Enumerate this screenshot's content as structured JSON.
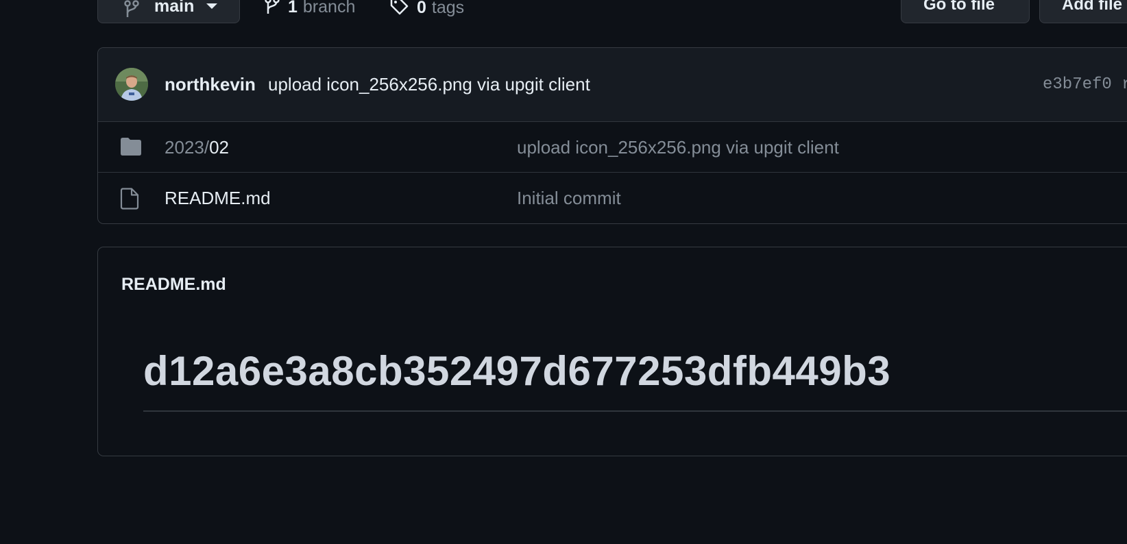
{
  "toolbar": {
    "branch": "main",
    "branch_count": "1",
    "branch_label": "branch",
    "tag_count": "0",
    "tag_label": "tags",
    "goto_file": "Go to file",
    "add_file": "Add file"
  },
  "commit": {
    "author": "northkevin",
    "message": "upload icon_256x256.png via upgit client",
    "sha": "e3b7ef0 r"
  },
  "files": [
    {
      "type": "folder",
      "prefix": "2023/",
      "name": "02",
      "message": "upload icon_256x256.png via upgit client"
    },
    {
      "type": "file",
      "prefix": "",
      "name": "README.md",
      "message": "Initial commit"
    }
  ],
  "readme": {
    "title": "README.md",
    "heading": "d12a6e3a8cb352497d677253dfb449b3"
  },
  "colors": {
    "background": "#0d1117",
    "panel": "#161b22",
    "border": "#30363d",
    "text": "#e6edf3",
    "muted": "#848d97"
  }
}
